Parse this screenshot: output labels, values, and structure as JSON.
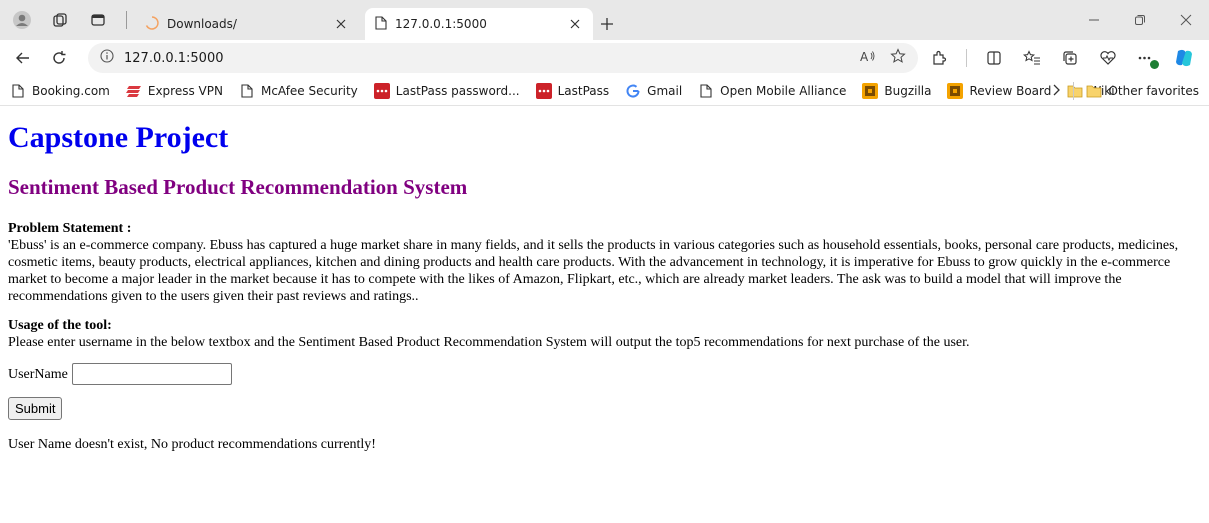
{
  "tabs": [
    {
      "title": "Downloads/",
      "icon": "loading-spinner-icon",
      "active": false
    },
    {
      "title": "127.0.0.1:5000",
      "icon": "page-icon",
      "active": true
    }
  ],
  "addressbar": {
    "url": "127.0.0.1:5000"
  },
  "favorites": [
    {
      "label": "Booking.com",
      "icon": "page-icon"
    },
    {
      "label": "Express VPN",
      "icon": "expressvpn-icon"
    },
    {
      "label": "McAfee Security",
      "icon": "page-icon"
    },
    {
      "label": "LastPass password...",
      "icon": "lastpass-icon"
    },
    {
      "label": "LastPass",
      "icon": "lastpass-icon"
    },
    {
      "label": "Gmail",
      "icon": "google-icon"
    },
    {
      "label": "Open Mobile Alliance",
      "icon": "page-icon"
    },
    {
      "label": "Bugzilla",
      "icon": "bugzilla-icon"
    },
    {
      "label": "Review Board",
      "icon": "reviewboard-icon"
    },
    {
      "label": "Wiki",
      "icon": "folder-icon"
    }
  ],
  "other_favorites": "Other favorites",
  "page": {
    "title": "Capstone Project",
    "subtitle": "Sentiment Based Product Recommendation System",
    "problem_label": "Problem Statement :",
    "problem_text": "'Ebuss' is an e-commerce company. Ebuss has captured a huge market share in many fields, and it sells the products in various categories such as household essentials, books, personal care products, medicines, cosmetic items, beauty products, electrical appliances, kitchen and dining products and health care products. With the advancement in technology, it is imperative for Ebuss to grow quickly in the e-commerce market to become a major leader in the market because it has to compete with the likes of Amazon, Flipkart, etc., which are already market leaders. The ask was to build a model that will improve the recommendations given to the users given their past reviews and ratings..",
    "usage_label": "Usage of the tool:",
    "usage_text": "Please enter username in the below textbox and the Sentiment Based Product Recommendation System will output the top5 recommendations for next purchase of the user.",
    "username_label": "UserName",
    "username_value": "",
    "submit_label": "Submit",
    "result_message": "User Name doesn't exist, No product recommendations currently!"
  },
  "colors": {
    "title": "#0000ee",
    "subtitle": "#800080",
    "tabstrip_bg": "#e8e8e8"
  }
}
